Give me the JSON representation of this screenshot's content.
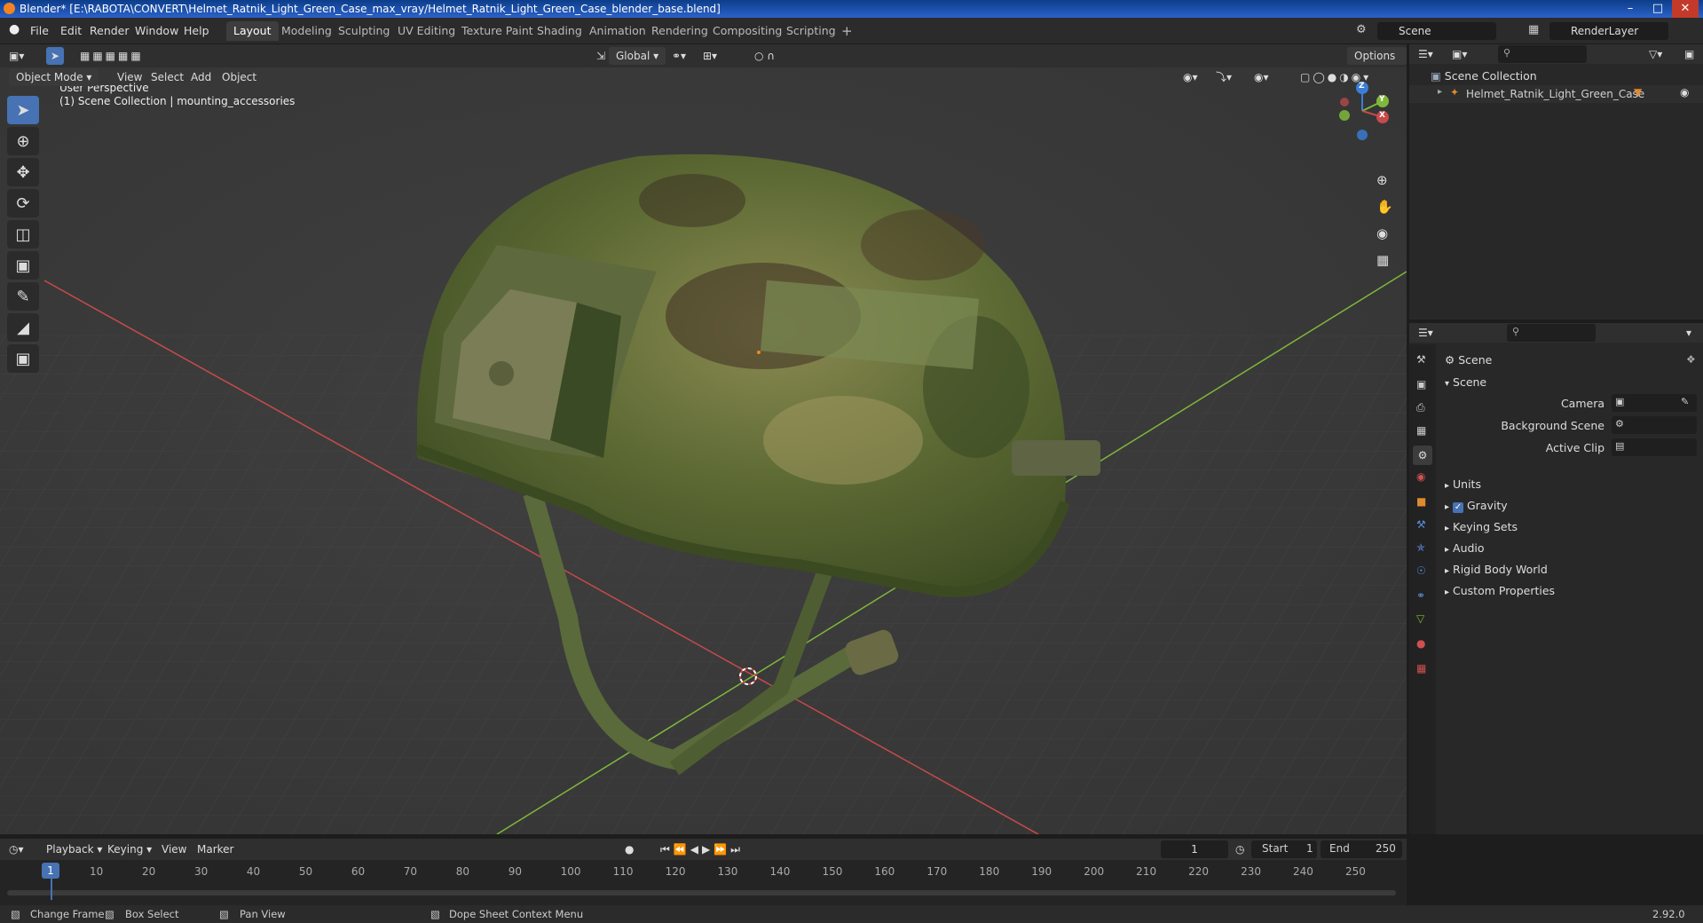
{
  "window": {
    "title": "Blender* [E:\\RABOTA\\CONVERT\\Helmet_Ratnik_Light_Green_Case_max_vray/Helmet_Ratnik_Light_Green_Case_blender_base.blend]"
  },
  "menu": [
    "File",
    "Edit",
    "Render",
    "Window",
    "Help"
  ],
  "workspaces": [
    "Layout",
    "Modeling",
    "Sculpting",
    "UV Editing",
    "Texture Paint",
    "Shading",
    "Animation",
    "Rendering",
    "Compositing",
    "Scripting"
  ],
  "active_workspace": "Layout",
  "scene_field": "Scene",
  "renderlayer_field": "RenderLayer",
  "viewport_header": {
    "mode": "Object Mode",
    "menus": [
      "View",
      "Select",
      "Add",
      "Object"
    ],
    "transform": "Global",
    "options": "Options"
  },
  "viewport": {
    "perspective": "User Perspective",
    "collection_info": "(1) Scene Collection | mounting_accessories"
  },
  "gizmo": {
    "z": "Z",
    "y": "Y",
    "x": "X"
  },
  "outliner": {
    "root": "Scene Collection",
    "items": [
      "Helmet_Ratnik_Light_Green_Case"
    ]
  },
  "properties": {
    "context": "Scene",
    "panel": "Scene",
    "fields": [
      {
        "label": "Camera"
      },
      {
        "label": "Background Scene"
      },
      {
        "label": "Active Clip"
      }
    ],
    "subpanels": [
      "Units",
      "Gravity",
      "Keying Sets",
      "Audio",
      "Rigid Body World",
      "Custom Properties"
    ],
    "gravity_checked": true
  },
  "timeline": {
    "menus": [
      "Playback",
      "Keying",
      "View",
      "Marker"
    ],
    "current_frame": "1",
    "start_label": "Start",
    "start": "1",
    "end_label": "End",
    "end": "250",
    "ticks": [
      "1",
      "10",
      "20",
      "30",
      "40",
      "50",
      "60",
      "70",
      "80",
      "90",
      "100",
      "110",
      "120",
      "130",
      "140",
      "150",
      "160",
      "170",
      "180",
      "190",
      "200",
      "210",
      "220",
      "230",
      "240",
      "250"
    ]
  },
  "statusbar": {
    "items": [
      "Change Frame",
      "Box Select",
      "Pan View",
      "Dope Sheet Context Menu"
    ],
    "version": "2.92.0"
  },
  "colors": {
    "accent": "#4772b3",
    "axis_x": "#c94a4a",
    "axis_y": "#7fb83a",
    "axis_z": "#3b7ed8"
  }
}
